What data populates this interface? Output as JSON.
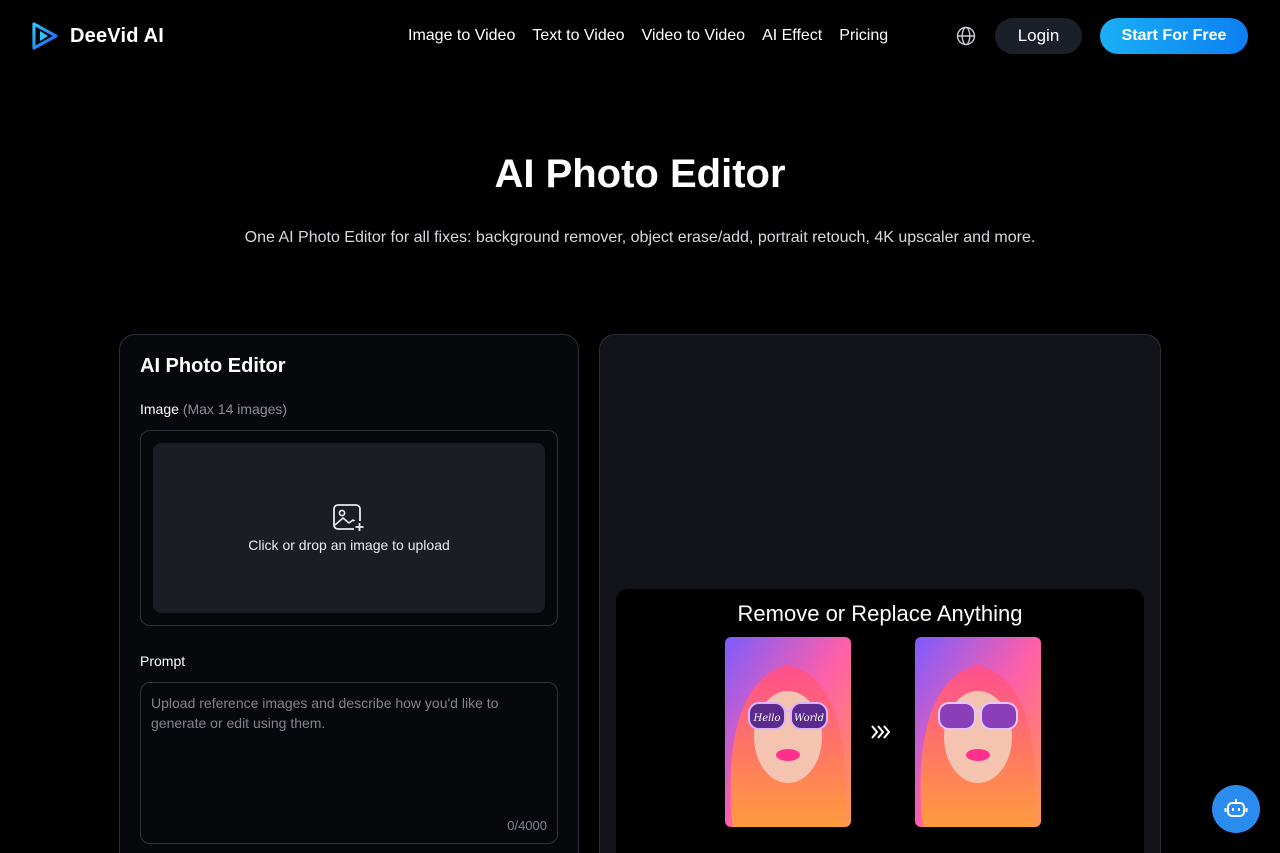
{
  "header": {
    "brand": "DeeVid AI",
    "nav": [
      "Image to Video",
      "Text to Video",
      "Video to Video",
      "AI Effect",
      "Pricing"
    ],
    "language_icon": "globe-icon",
    "login_label": "Login",
    "cta_label": "Start For Free"
  },
  "hero": {
    "title": "AI Photo Editor",
    "subtitle": "One AI Photo Editor for all fixes: background remover, object erase/add, portrait retouch, 4K upscaler and more."
  },
  "editor": {
    "title": "AI Photo Editor",
    "image_label": "Image",
    "image_hint": "(Max 14 images)",
    "upload_text": "Click or drop an image to upload",
    "prompt_label": "Prompt",
    "prompt_value": "",
    "prompt_placeholder": "Upload reference images and describe how you'd like to generate or edit using them.",
    "char_count": "0/4000"
  },
  "preview": {
    "demo_title": "Remove or Replace Anything",
    "before_overlay_text": "Hello World"
  },
  "colors": {
    "accent": "#0d7ff2",
    "cta_gradient_start": "#1ab0f5",
    "bot_button": "#2b8cf0",
    "background": "#000000"
  },
  "floating": {
    "bot_icon": "robot-icon"
  }
}
